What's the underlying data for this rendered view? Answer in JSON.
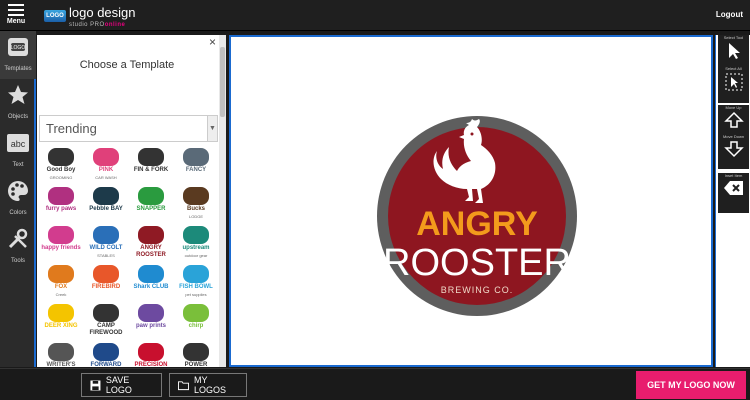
{
  "topbar": {
    "menu_label": "Menu",
    "brand_badge": "LOGO",
    "brand_name": "logo design",
    "brand_sub_prefix": "studio PRO",
    "brand_sub_suffix": "online",
    "logout_label": "Logout"
  },
  "tools": [
    {
      "label": "Templates",
      "icon": "templates-icon",
      "active": true
    },
    {
      "label": "Objects",
      "icon": "star-icon"
    },
    {
      "label": "Text",
      "icon": "text-icon"
    },
    {
      "label": "Colors",
      "icon": "palette-icon"
    },
    {
      "label": "Tools",
      "icon": "tools-icon"
    }
  ],
  "panel": {
    "close_glyph": "×",
    "title": "Choose a Template",
    "category": "Trending",
    "templates": [
      {
        "name": "Good Boy",
        "sub": "GROOMING",
        "color": "#333333"
      },
      {
        "name": "PINK",
        "sub": "CAR WASH",
        "color": "#e0407a"
      },
      {
        "name": "FIN & FORK",
        "sub": "",
        "color": "#333333"
      },
      {
        "name": "FANCY",
        "sub": "",
        "color": "#5a6a78"
      },
      {
        "name": "furry paws",
        "sub": "",
        "color": "#b03080"
      },
      {
        "name": "Pebble BAY",
        "sub": "",
        "color": "#1d3a4a"
      },
      {
        "name": "SNAPPER",
        "sub": "",
        "color": "#2a9b3f"
      },
      {
        "name": "Bucks",
        "sub": "LODGE",
        "color": "#5a3a20"
      },
      {
        "name": "happy friends",
        "sub": "",
        "color": "#d23c8e"
      },
      {
        "name": "WILD COLT",
        "sub": "STABLES",
        "color": "#2a6fb8"
      },
      {
        "name": "ANGRY ROOSTER",
        "sub": "",
        "color": "#8f1a24"
      },
      {
        "name": "upstream",
        "sub": "outdoor gear",
        "color": "#1c8a7a"
      },
      {
        "name": "FOX",
        "sub": "Creek",
        "color": "#e07a1d"
      },
      {
        "name": "FIREBIRD",
        "sub": "",
        "color": "#e8572a"
      },
      {
        "name": "Shark CLUB",
        "sub": "",
        "color": "#1f8bd0"
      },
      {
        "name": "FISH BOWL",
        "sub": "pet supplies",
        "color": "#2aa3d8"
      },
      {
        "name": "DEER XING",
        "sub": "",
        "color": "#f4c400"
      },
      {
        "name": "CAMP FIREWOOD",
        "sub": "",
        "color": "#333333"
      },
      {
        "name": "paw prints",
        "sub": "",
        "color": "#6d4aa0"
      },
      {
        "name": "chirp",
        "sub": "",
        "color": "#7abf3a"
      },
      {
        "name": "WRITER'S",
        "sub": "",
        "color": "#555555"
      },
      {
        "name": "FORWARD",
        "sub": "",
        "color": "#1f4a8a"
      },
      {
        "name": "PRECISION",
        "sub": "",
        "color": "#c8102e"
      },
      {
        "name": "POWER",
        "sub": "",
        "color": "#333333"
      }
    ]
  },
  "canvas_logo": {
    "line1": "ANGRY",
    "line2": "ROOSTER",
    "line3": "BREWING CO.",
    "ring_color": "#5e5e5e",
    "fill_color": "#8e1620",
    "accent_color": "#f39b1c"
  },
  "right_tools": {
    "select_tool_label": "Select Tool",
    "select_all_label": "Select All",
    "move_up_label": "Move Up",
    "move_down_label": "Move Down",
    "delete_label": "Inset Item"
  },
  "bottom": {
    "save_label": "SAVE LOGO",
    "mylogos_label": "MY LOGOS",
    "cta_label": "GET MY LOGO NOW"
  },
  "colors": {
    "accent_blue": "#1a6ad0",
    "cta_pink": "#e81d6e"
  }
}
